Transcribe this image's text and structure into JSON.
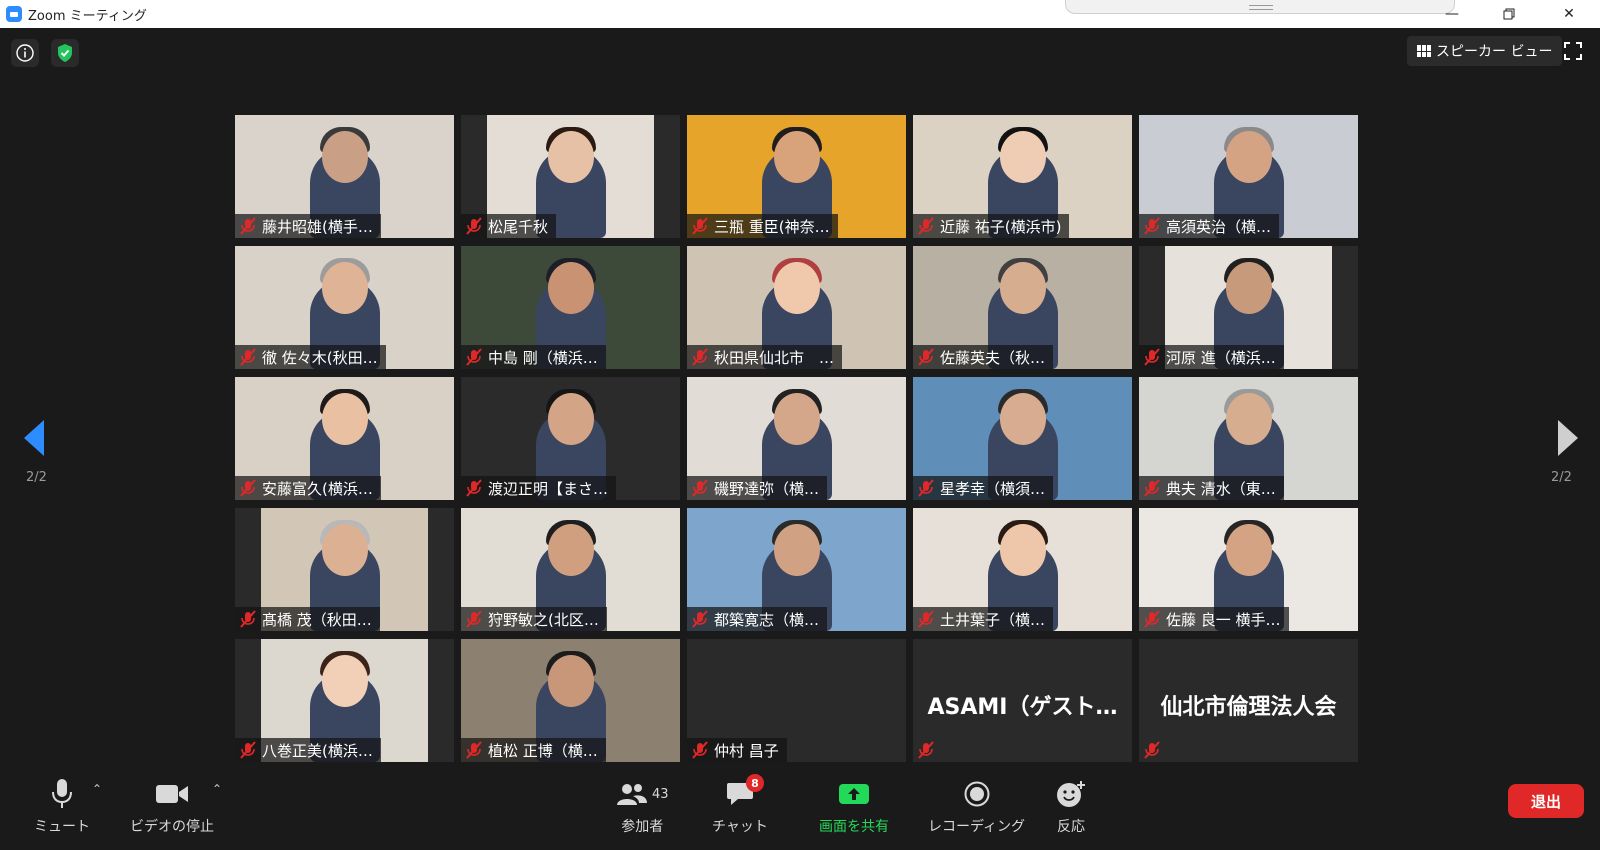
{
  "window": {
    "title": "Zoom ミーティング"
  },
  "top": {
    "view_label": "スピーカー ビュー"
  },
  "nav": {
    "left_page": "2/2",
    "right_page": "2/2"
  },
  "participants": [
    {
      "name": "藤井昭雄(横手…",
      "bg": "#d9d3cc",
      "skin": "#c9a086",
      "hair": "#3a3a3a"
    },
    {
      "name": "松尾千秋",
      "bg": "#e3ddd6",
      "skin": "#e7c1a6",
      "hair": "#2a1a12"
    },
    {
      "name": "三瓶 重臣(神奈…",
      "bg": "#e6a42a",
      "skin": "#d8a27a",
      "hair": "#1e1e1e"
    },
    {
      "name": "近藤 祐子(横浜市)",
      "bg": "#dbd2c3",
      "skin": "#efcdb5",
      "hair": "#121212"
    },
    {
      "name": "高須英治（横…",
      "bg": "#c9ccd2",
      "skin": "#d4a384",
      "hair": "#8a8a8a"
    },
    {
      "name": "徹 佐々木(秋田…",
      "bg": "#d8d2c9",
      "skin": "#dfb395",
      "hair": "#9c9c9c"
    },
    {
      "name": "中島 剛（横浜…",
      "bg": "#3d4a3a",
      "skin": "#c99273",
      "hair": "#1c1f28"
    },
    {
      "name": "秋田県仙北市　…",
      "bg": "#cfc3b3",
      "skin": "#f0c9ac",
      "hair": "#b04040"
    },
    {
      "name": "佐藤英夫（秋…",
      "bg": "#b8b0a2",
      "skin": "#d7ad8f",
      "hair": "#404040"
    },
    {
      "name": "河原 進（横浜…",
      "bg": "#e6e1da",
      "skin": "#c89a7c",
      "hair": "#202020"
    },
    {
      "name": "安藤富久(横浜…",
      "bg": "#d9d1c6",
      "skin": "#eac0a3",
      "hair": "#1f1a18"
    },
    {
      "name": "渡辺正明【まさ…",
      "bg": "#2b2b2b",
      "skin": "#d3a485",
      "hair": "#151515"
    },
    {
      "name": "磯野達弥（横…",
      "bg": "#e1ddd6",
      "skin": "#d4a78a",
      "hair": "#222222"
    },
    {
      "name": "星孝幸（横須…",
      "bg": "#5f8fb8",
      "skin": "#d8ac90",
      "hair": "#2a2a2a"
    },
    {
      "name": "典夫 清水（東…",
      "bg": "#d5d5d2",
      "skin": "#d7ad8f",
      "hair": "#9a9a9a"
    },
    {
      "name": "髙橋 茂（秋田…",
      "bg": "#d2c7b6",
      "skin": "#dcb092",
      "hair": "#b8b8b8"
    },
    {
      "name": "狩野敏之(北区…",
      "bg": "#e1ddd4",
      "skin": "#cf9f80",
      "hair": "#1e1e1e"
    },
    {
      "name": "都築寛志（横…",
      "bg": "#7ea6cc",
      "skin": "#d0a283",
      "hair": "#2b2b2b"
    },
    {
      "name": "土井葉子（横…",
      "bg": "#e6e0d8",
      "skin": "#eec6aa",
      "hair": "#2a1a14"
    },
    {
      "name": "佐藤 良一 横手…",
      "bg": "#ebe8e4",
      "skin": "#d3a384",
      "hair": "#262626"
    },
    {
      "name": "八巻正美(横浜…",
      "bg": "#ddd8cf",
      "skin": "#f2d0b8",
      "hair": "#3a2418"
    },
    {
      "name": "植松 正博（横…",
      "bg": "#8c8070",
      "skin": "#c8977a",
      "hair": "#1c1c1c"
    },
    {
      "name": "仲村 昌子",
      "bg": "",
      "skin": "",
      "hair": ""
    },
    {
      "name": "ASAMI（ゲスト…",
      "bg": "",
      "skin": "",
      "hair": ""
    },
    {
      "name": "仙北市倫理法人会",
      "bg": "",
      "skin": "",
      "hair": ""
    }
  ],
  "toolbar": {
    "mute": "ミュート",
    "video": "ビデオの停止",
    "participants": "参加者",
    "participant_count": "43",
    "chat": "チャット",
    "chat_badge": "8",
    "share": "画面を共有",
    "record": "レコーディング",
    "reactions": "反応",
    "leave": "退出"
  },
  "colors": {
    "accent_blue": "#2d8cff",
    "share_green": "#23d959",
    "leave_red": "#e02828",
    "shield_green": "#23c45b",
    "mic_muted": "#e02828"
  }
}
